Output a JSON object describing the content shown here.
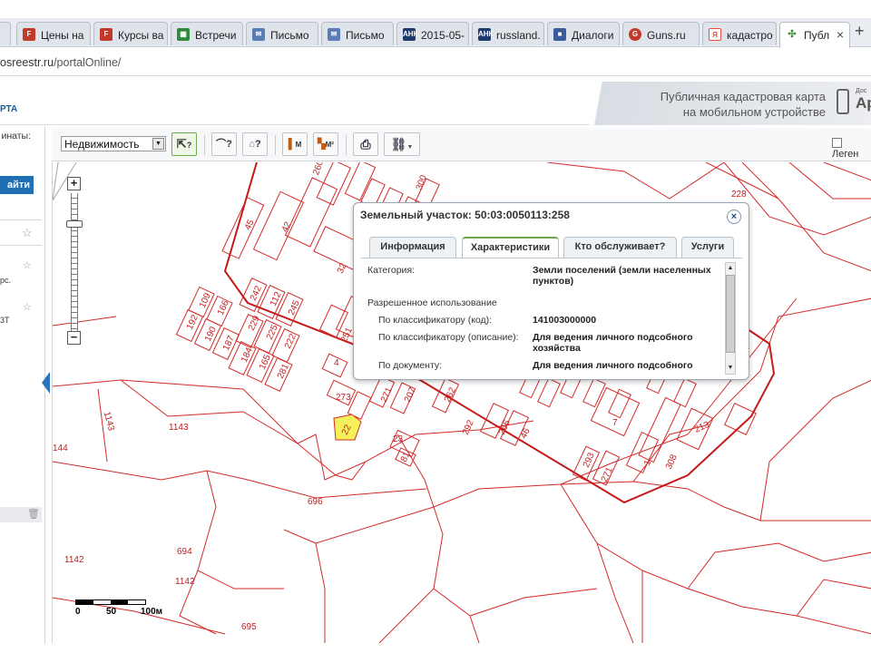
{
  "browser": {
    "tabs": [
      {
        "label": "Цены на",
        "icon": "sheet-f-icon",
        "color": "#c0392b"
      },
      {
        "label": "Курсы ва",
        "icon": "sheet-f-icon",
        "color": "#c0392b"
      },
      {
        "label": "Встречи",
        "icon": "calendar-grid-icon",
        "color": "#2e8b3e"
      },
      {
        "label": "Письмо",
        "icon": "mail-icon",
        "color": "#5b7db5"
      },
      {
        "label": "Письмо",
        "icon": "mail-icon",
        "color": "#5b7db5"
      },
      {
        "label": "2015-05-",
        "icon": "ank-icon",
        "color": "#1e3a6e"
      },
      {
        "label": "russland.",
        "icon": "ank-icon",
        "color": "#1e3a6e"
      },
      {
        "label": "Диалоги",
        "icon": "chat-icon",
        "color": "#3b5b9a"
      },
      {
        "label": "Guns.ru",
        "icon": "guns-icon",
        "color": "#c0392b"
      },
      {
        "label": "кадастро",
        "icon": "yandex-icon",
        "color": "#e74c3c"
      },
      {
        "label": "Публ",
        "icon": "active-page-icon",
        "color": "#555555"
      }
    ],
    "tab_close": "×",
    "new_tab": "+",
    "url_domain": "osreestr.ru",
    "url_path": "/portalOnline/"
  },
  "header": {
    "logo_text": "РТА",
    "banner_line1": "Публичная кадастровая карта",
    "banner_line2": "на мобильном устройстве",
    "app_small": "Дос",
    "app_big": "Ap"
  },
  "sidebar": {
    "coord_label": "инаты:",
    "find_button": "айти",
    "item1": "рс.",
    "item2": "3Т"
  },
  "toolbar": {
    "layer_value": "Недвижимость",
    "legend_label": "Леген",
    "btn_identify": "?",
    "btn_area_query": "?",
    "btn_object_query": "?",
    "btn_measure_line": "М",
    "btn_measure_area": "М²",
    "btn_print": "print",
    "btn_link": "link"
  },
  "map": {
    "parcel_labels": [
      "228",
      "260",
      "300",
      "45",
      "42",
      "32",
      "109",
      "166",
      "242",
      "112",
      "245",
      "192",
      "190",
      "229",
      "225",
      "222",
      "187",
      "184",
      "165",
      "281",
      "251",
      "4",
      "23",
      "207",
      "271",
      "262",
      "266",
      "46",
      "292",
      "7",
      "213",
      "293",
      "271",
      "308",
      "1",
      "23",
      "81",
      "22",
      "1143",
      "1143",
      "144",
      "696",
      "694",
      "1142",
      "1142",
      "695"
    ],
    "scale_labels": [
      "0",
      "50",
      "100м"
    ]
  },
  "popup": {
    "title": "Земельный участок: 50:03:0050113:258",
    "close": "×",
    "tabs": [
      "Информация",
      "Характеристики",
      "Кто обслуживает?",
      "Услуги"
    ],
    "active_tab": "Характеристики",
    "rows": {
      "category_label": "Категория:",
      "category_value": "Земли поселений (земли населенных пунктов)",
      "permitted_use_label": "Разрешенное использование",
      "by_code_label": "По классификатору (код):",
      "by_code_value": "141003000000",
      "by_desc_label": "По классификатору (описание):",
      "by_desc_value": "Для ведения личного подсобного хозяйства",
      "by_doc_label": "По документу:",
      "by_doc_value": "Для ведения личного подсобного"
    }
  },
  "colors": {
    "parcel_line": "#d42a2a",
    "selected_parcel": "#f6f05a",
    "find_button": "#1f6fb5",
    "active_tab_accent": "#6aa84f"
  }
}
